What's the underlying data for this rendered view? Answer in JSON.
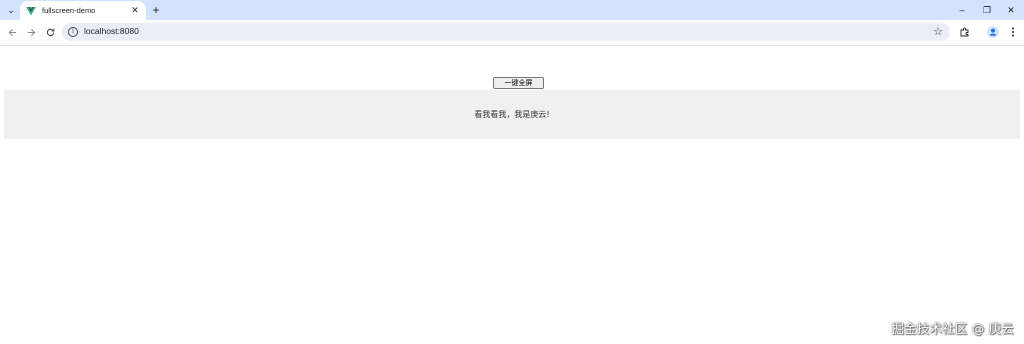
{
  "browser": {
    "tab": {
      "title": "fullscreen-demo",
      "close_glyph": "✕"
    },
    "new_tab_glyph": "+",
    "tab_search_glyph": "⌄",
    "window_controls": {
      "minimize": "–",
      "restore": "❐",
      "close": "✕"
    },
    "address": {
      "url": "localhost:8080"
    },
    "icons": {
      "back": "back-arrow-icon",
      "forward": "forward-arrow-icon",
      "reload": "reload-icon",
      "info": "info-icon",
      "bookmark": "star-icon",
      "extensions": "puzzle-icon",
      "profile": "profile-icon",
      "menu": "kebab-menu-icon"
    }
  },
  "page": {
    "fullscreen_button_label": "一键全屏",
    "fullscreen_content_text": "看我看我，我是庚云!"
  },
  "watermark": "掘金技术社区 @ 庚云",
  "colors": {
    "tabstrip": "#d3e3fd",
    "omnibox": "#e9eef6",
    "content_box": "#f0f0f0",
    "vue_green": "#41b883",
    "vue_dark": "#35495e",
    "profile_blue": "#1a73e8"
  }
}
